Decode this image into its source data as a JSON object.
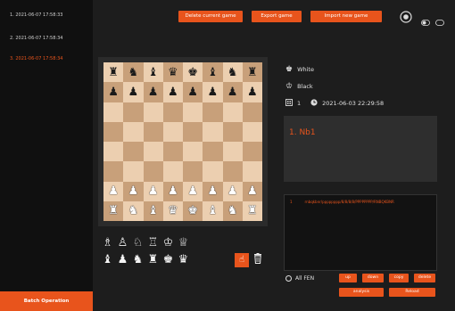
{
  "sidebar": {
    "games": [
      {
        "label": "1.  2021-06-07 17:58:33"
      },
      {
        "label": "2.  2021-06-07 17:58:34"
      },
      {
        "label": "3.  2021-06-07 17:58:34"
      }
    ],
    "active_index": 2,
    "batch_label": "Batch Operation"
  },
  "toolbar": {
    "delete_label": "Delete current game",
    "export_label": "Export game",
    "import_label": "Import new game",
    "icons": [
      "circle-button-icon",
      "toggle-icon",
      "toggle-off-icon"
    ]
  },
  "board": {
    "ranks": [
      [
        "r",
        "n",
        "b",
        "q",
        "k",
        "b",
        "n",
        "r"
      ],
      [
        "p",
        "p",
        "p",
        "p",
        "p",
        "p",
        "p",
        "p"
      ],
      [
        "",
        "",
        "",
        "",
        "",
        "",
        "",
        ""
      ],
      [
        "",
        "",
        "",
        "",
        "",
        "",
        "",
        ""
      ],
      [
        "",
        "",
        "",
        "",
        "",
        "",
        "",
        ""
      ],
      [
        "",
        "",
        "",
        "",
        "",
        "",
        "",
        ""
      ],
      [
        "P",
        "P",
        "P",
        "P",
        "P",
        "P",
        "P",
        "P"
      ],
      [
        "R",
        "N",
        "B",
        "Q",
        "K",
        "B",
        "N",
        "R"
      ]
    ]
  },
  "palette": {
    "white": [
      "♗",
      "♙",
      "♘",
      "♖",
      "♔",
      "♕"
    ],
    "black": [
      "♝",
      "♟",
      "♞",
      "♜",
      "♚",
      "♛"
    ]
  },
  "info": {
    "white_label": "White",
    "black_label": "Black",
    "round": "1",
    "datetime": "2021-06-03 22:29:58"
  },
  "moves": {
    "text": "1. Nb1"
  },
  "fen": {
    "rows": [
      {
        "index": "1",
        "value": "rnbqkbnr/pppppppp/8/8/8/8/PPPPPPPP/RNBQKBNR"
      }
    ]
  },
  "controls": {
    "allfen_label": "All FEN",
    "buttons": [
      "up",
      "down",
      "copy",
      "delete"
    ],
    "analysis_label": "analysis",
    "reload_label": "Reload"
  },
  "colors": {
    "accent": "#e8541c",
    "background": "#1d1d1d",
    "sidebar": "#101010",
    "light_square": "#eccfb0",
    "dark_square": "#c8a07a"
  }
}
